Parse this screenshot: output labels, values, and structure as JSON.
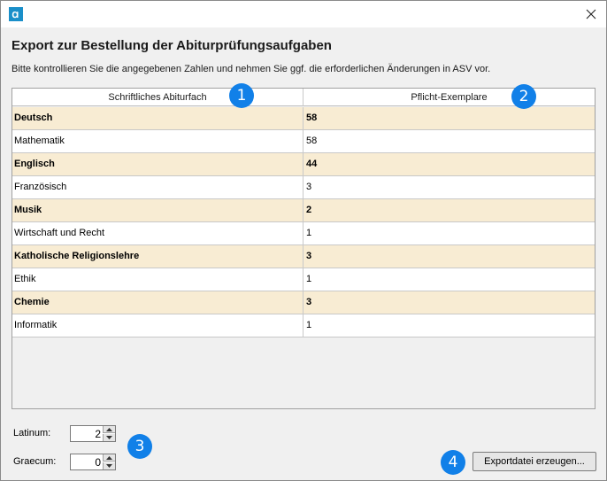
{
  "window": {
    "app_icon": "asv-logo-icon",
    "close_icon": "close-icon"
  },
  "dialog": {
    "heading": "Export zur Bestellung der Abiturprüfungsaufgaben",
    "description": "Bitte kontrollieren Sie die angegebenen Zahlen und nehmen Sie ggf. die erforderlichen Änderungen in ASV vor."
  },
  "table": {
    "columns": [
      "Schriftliches Abiturfach",
      "Pflicht-Exemplare"
    ],
    "rows": [
      {
        "subject": "Deutsch",
        "count": "58"
      },
      {
        "subject": "Mathematik",
        "count": "58"
      },
      {
        "subject": "Englisch",
        "count": "44"
      },
      {
        "subject": "Französisch",
        "count": "3"
      },
      {
        "subject": "Musik",
        "count": "2"
      },
      {
        "subject": "Wirtschaft und Recht",
        "count": "1"
      },
      {
        "subject": "Katholische Religionslehre",
        "count": "3"
      },
      {
        "subject": "Ethik",
        "count": "1"
      },
      {
        "subject": "Chemie",
        "count": "3"
      },
      {
        "subject": "Informatik",
        "count": "1"
      }
    ],
    "row_colors": {
      "odd": "#f8ecd3",
      "even": "#ffffff"
    }
  },
  "fields": {
    "latinum_label": "Latinum:",
    "latinum_value": "2",
    "graecum_label": "Graecum:",
    "graecum_value": "0"
  },
  "export_button_label": "Exportdatei erzeugen...",
  "badges": [
    "1",
    "2",
    "3",
    "4"
  ],
  "accent_color": "#1180e8"
}
